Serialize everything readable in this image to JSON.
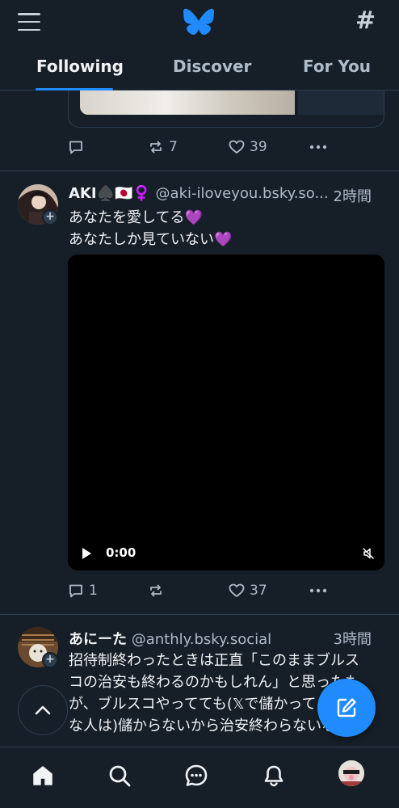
{
  "header": {
    "tabs": [
      {
        "label": "Following",
        "active": true
      },
      {
        "label": "Discover",
        "active": false
      },
      {
        "label": "For You",
        "active": false
      }
    ],
    "logo_icon": "butterfly-icon",
    "feeds_icon": "hash-icon",
    "menu_icon": "hamburger-icon"
  },
  "previous_post": {
    "reply_count": "",
    "repost_count": "7",
    "like_count": "39"
  },
  "posts": [
    {
      "display_name": "AKI♠️🇯🇵♀️",
      "handle": "@aki-iloveyou.bsky.so...",
      "time": "2時間",
      "text_lines": [
        "あなたを愛してる💜",
        "あなたしか見ていない💜"
      ],
      "video_time": "0:00",
      "reply_count": "1",
      "repost_count": "",
      "like_count": "37"
    },
    {
      "display_name": "あにーた",
      "handle": "@anthly.bsky.social",
      "time": "3時間",
      "text_lines": [
        "招待制終わったときは正直「このままブルス",
        "コの治安も終わるのかもしれん」と思ったも",
        "が、ブルスコやってても(𝕏で儲かってるよう",
        "な人は)儲からないから治安終わらないな…と"
      ]
    }
  ],
  "colors": {
    "background": "#161e27",
    "accent": "#208bfe",
    "muted_text": "#aebbc9",
    "divider": "#2e4052"
  }
}
